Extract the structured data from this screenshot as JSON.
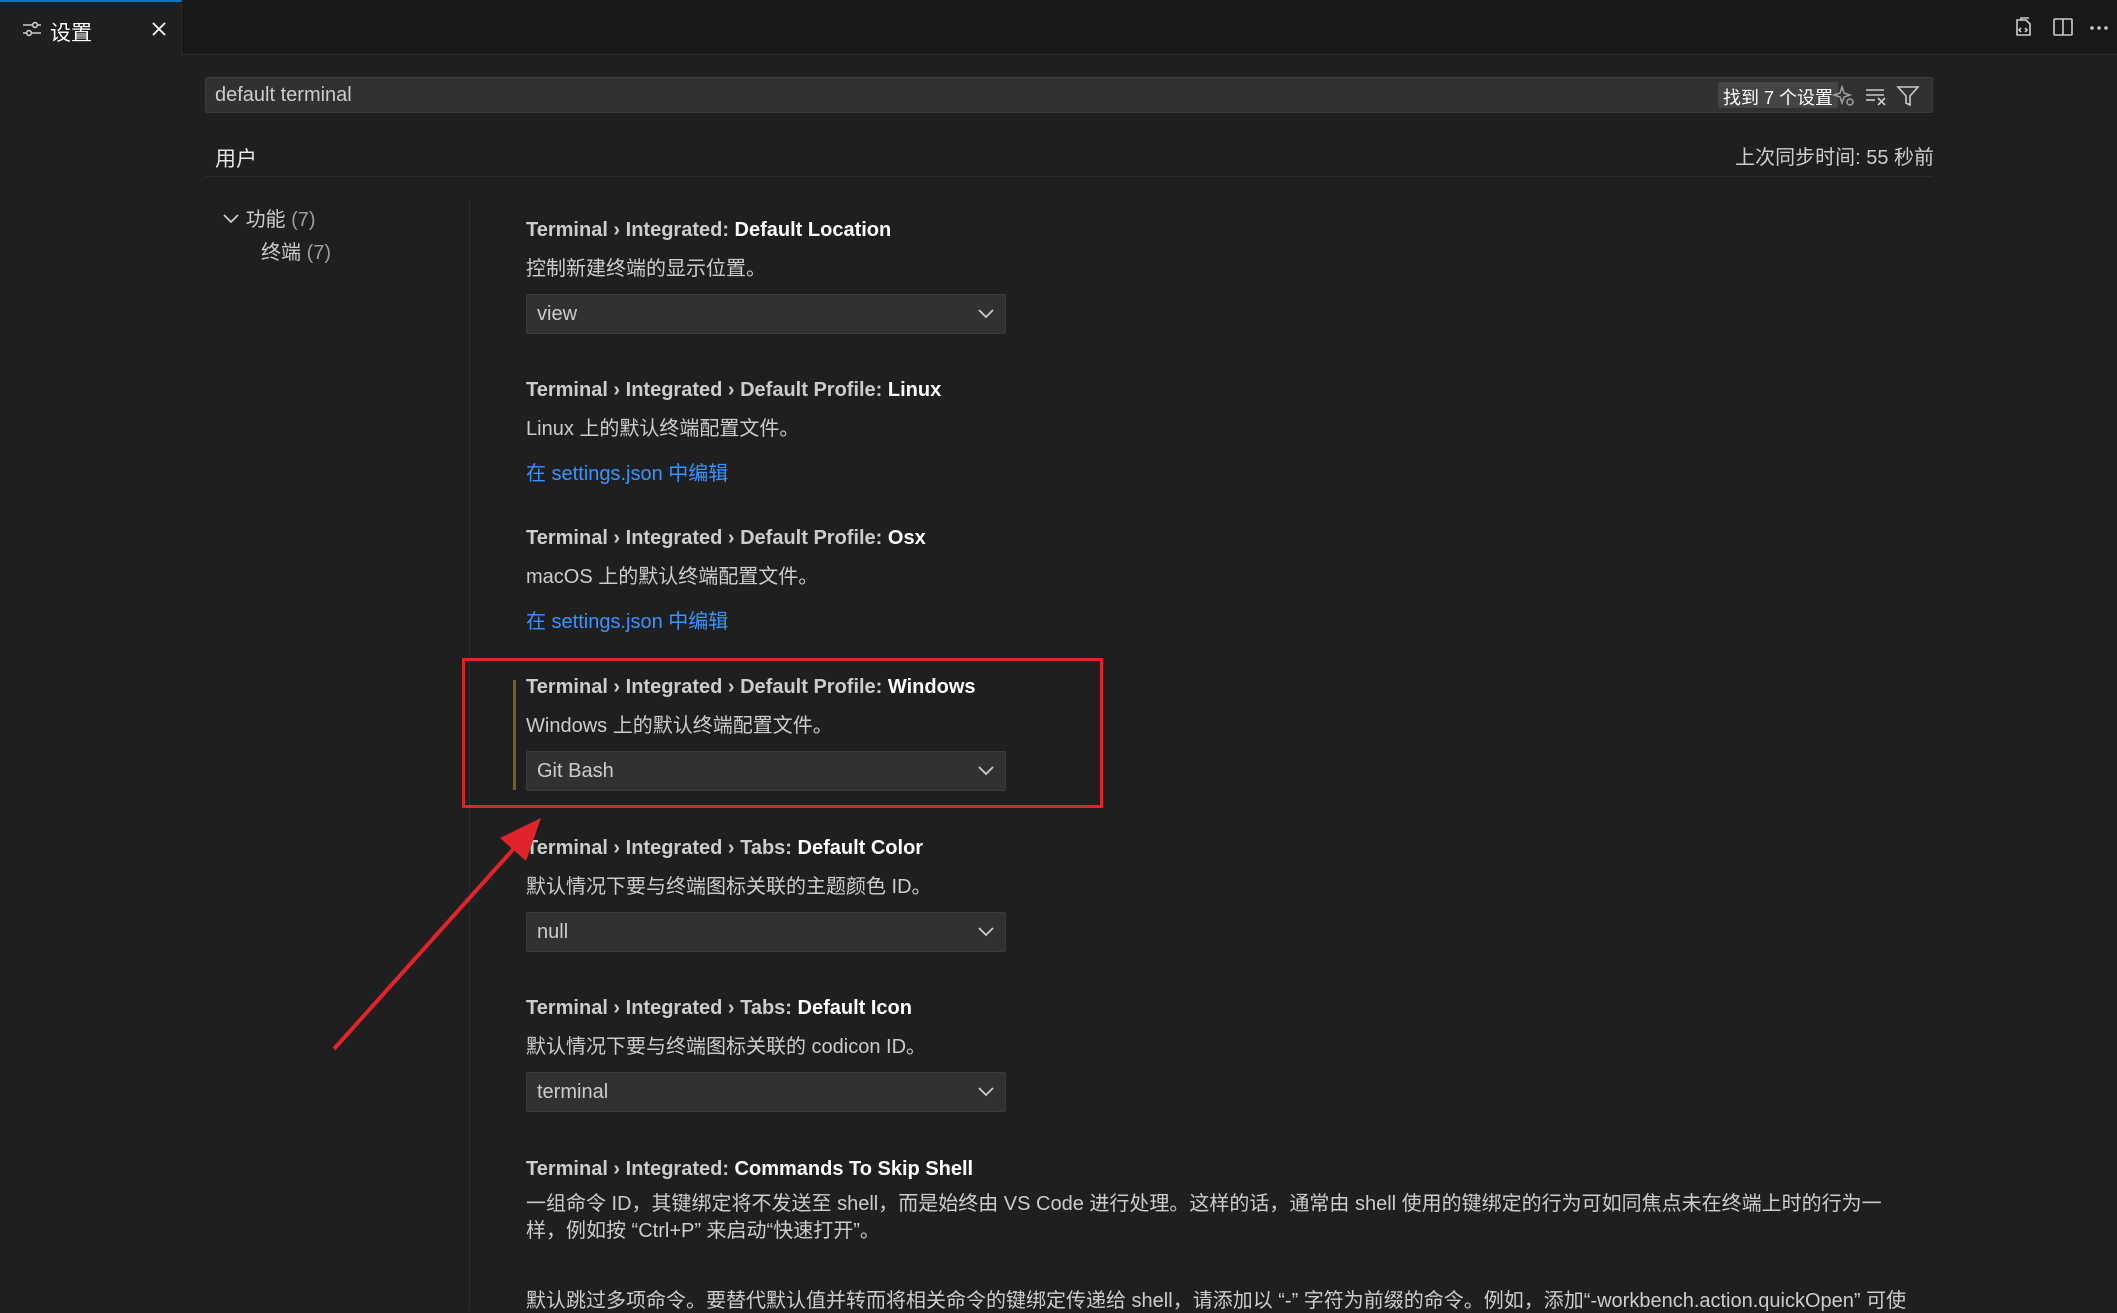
{
  "tab": {
    "label": "设置"
  },
  "search": {
    "value": "default terminal",
    "result_count": "找到 7 个设置"
  },
  "scope": {
    "user_tab": "用户",
    "sync_status": "上次同步时间: 55 秒前"
  },
  "toc": [
    {
      "label": "功能",
      "count": "(7)"
    },
    {
      "label": "终端",
      "count": "(7)"
    }
  ],
  "settings": [
    {
      "category": "Terminal › Integrated: ",
      "key": "Default Location",
      "description": "控制新建终端的显示位置。",
      "value": "view"
    },
    {
      "category": "Terminal › Integrated › Default Profile: ",
      "key": "Linux",
      "description": "Linux 上的默认终端配置文件。",
      "link": "在 settings.json 中编辑"
    },
    {
      "category": "Terminal › Integrated › Default Profile: ",
      "key": "Osx",
      "description": "macOS 上的默认终端配置文件。",
      "link": "在 settings.json 中编辑"
    },
    {
      "category": "Terminal › Integrated › Default Profile: ",
      "key": "Windows",
      "description": "Windows 上的默认终端配置文件。",
      "value": "Git Bash"
    },
    {
      "category": "Terminal › Integrated › Tabs: ",
      "key": "Default Color",
      "description": "默认情况下要与终端图标关联的主题颜色 ID。",
      "value": "null"
    },
    {
      "category": "Terminal › Integrated › Tabs: ",
      "key": "Default Icon",
      "description": "默认情况下要与终端图标关联的 codicon ID。",
      "value": "terminal"
    },
    {
      "category": "Terminal › Integrated: ",
      "key": "Commands To Skip Shell",
      "description": "一组命令 ID，其键绑定将不发送至 shell，而是始终由 VS Code 进行处理。这样的话，通常由 shell 使用的键绑定的行为可如同焦点未在终端上时的行为一样，例如按 “Ctrl+P” 来启动“快速打开”。",
      "description2": "默认跳过多项命令。要替代默认值并转而将相关命令的键绑定传递给 shell，请添加以 “-” 字符为前缀的命令。例如，添加“-workbench.action.quickOpen” 可使"
    }
  ],
  "colors": {
    "accent": "#0078d4",
    "annotation": "#e0242b",
    "link": "#3794ff",
    "modified": "#7a5e14"
  }
}
